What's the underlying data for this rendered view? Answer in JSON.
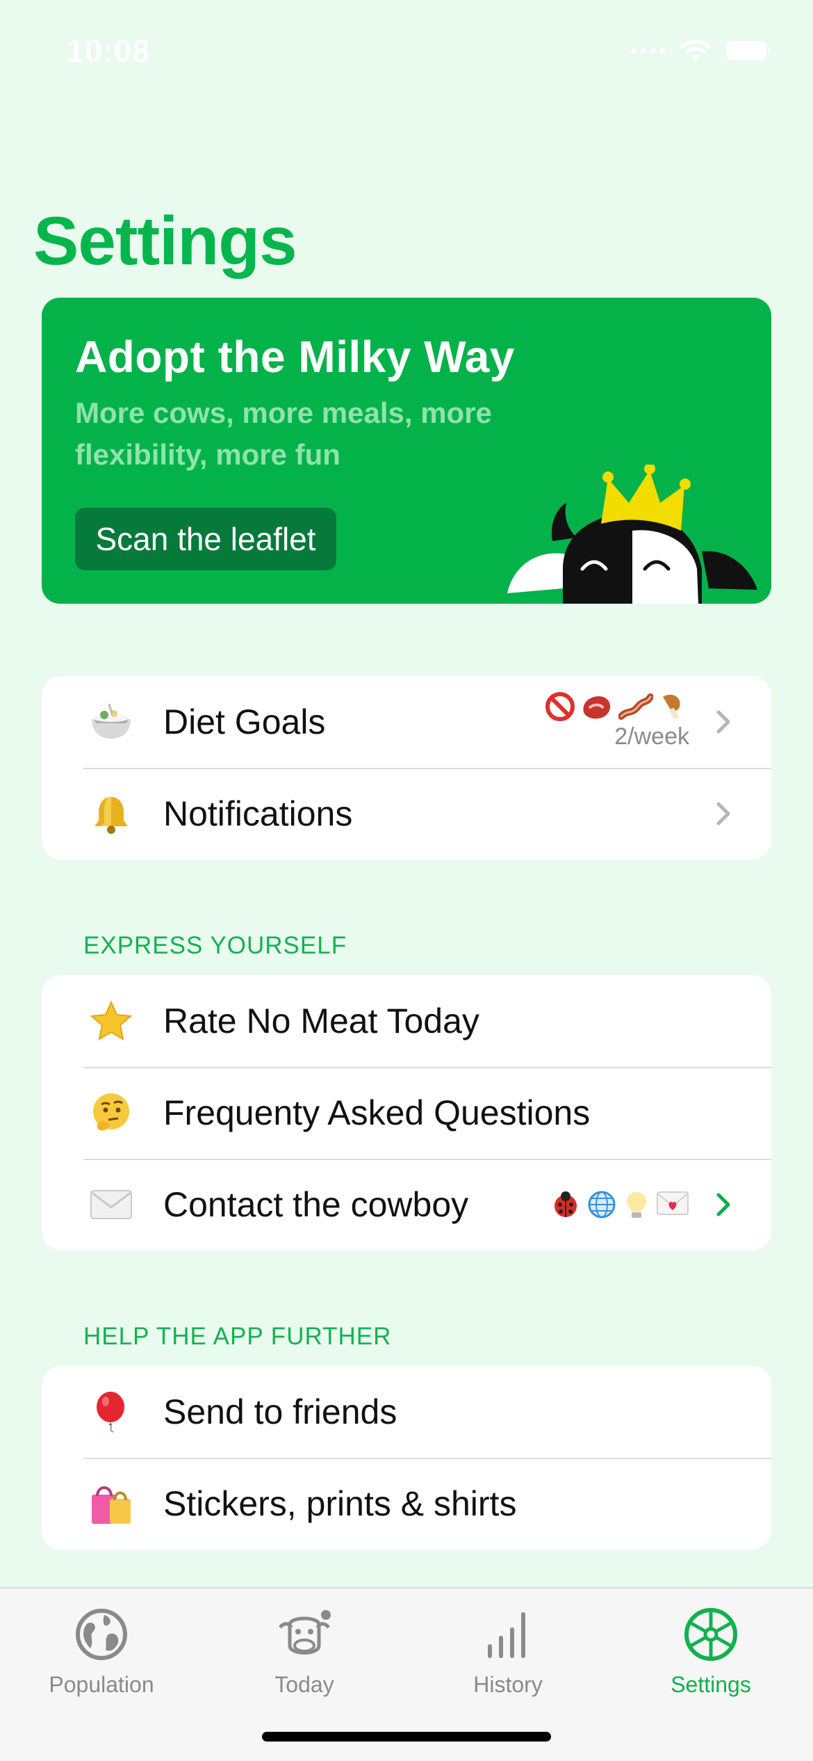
{
  "status_bar": {
    "time": "10:08"
  },
  "page": {
    "title": "Settings"
  },
  "promo": {
    "title": "Adopt the Milky Way",
    "subtitle": "More cows, more meals, more flexibility, more fun",
    "button_label": "Scan the leaflet"
  },
  "group_main": {
    "items": [
      {
        "label": "Diet Goals",
        "icon": "bowl-icon",
        "detail": "2/week",
        "badges": [
          "no-entry-icon",
          "meat-icon",
          "bacon-icon",
          "drumstick-icon"
        ]
      },
      {
        "label": "Notifications",
        "icon": "bell-icon"
      }
    ]
  },
  "group_express": {
    "header": "EXPRESS YOURSELF",
    "items": [
      {
        "label": "Rate No Meat Today",
        "icon": "star-icon"
      },
      {
        "label": "Frequenty Asked Questions",
        "icon": "thinking-face-icon"
      },
      {
        "label": "Contact the cowboy",
        "icon": "envelope-icon",
        "badges": [
          "ladybug-icon",
          "globe-icon",
          "lightbulb-icon",
          "love-letter-icon"
        ]
      }
    ]
  },
  "group_help": {
    "header": "HELP THE APP FURTHER",
    "items": [
      {
        "label": "Send to friends",
        "icon": "balloon-icon"
      },
      {
        "label": "Stickers, prints & shirts",
        "icon": "shopping-bags-icon"
      }
    ]
  },
  "tabbar": {
    "tabs": [
      {
        "label": "Population",
        "icon": "globe-icon",
        "active": false
      },
      {
        "label": "Today",
        "icon": "cow-icon",
        "active": false
      },
      {
        "label": "History",
        "icon": "bar-chart-icon",
        "active": false
      },
      {
        "label": "Settings",
        "icon": "wheel-icon",
        "active": true
      }
    ]
  },
  "colors": {
    "background": "#e9faef",
    "accent": "#06b64c",
    "promo_bg": "#04b24a",
    "promo_button": "#067a3a",
    "tab_inactive": "#8a8a8a"
  }
}
